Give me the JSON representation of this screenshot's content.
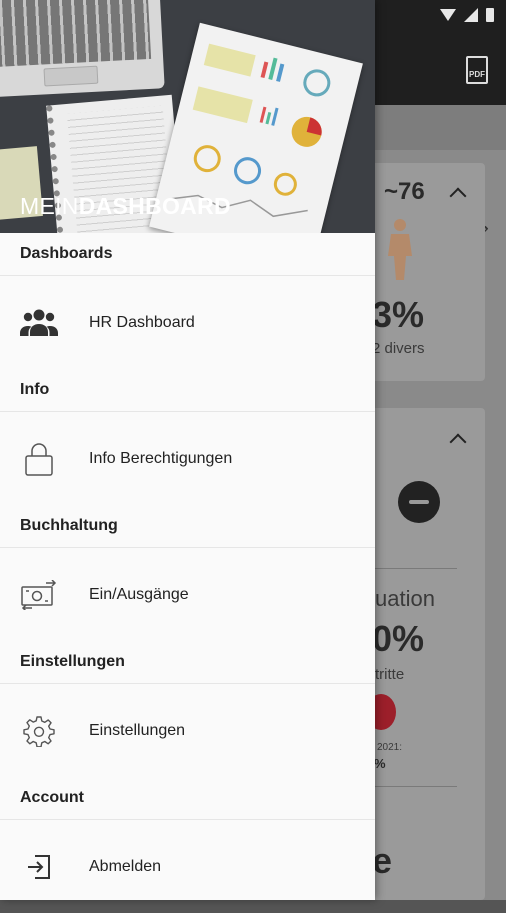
{
  "drawer": {
    "brand_light": "MEIN",
    "brand_bold": "DASHBOARD",
    "sections": [
      {
        "title": "Dashboards",
        "item_label": "HR Dashboard",
        "icon": "people-icon"
      },
      {
        "title": "Info",
        "item_label": "Info Berechtigungen",
        "icon": "lock-icon"
      },
      {
        "title": "Buchhaltung",
        "item_label": "Ein/Ausgänge",
        "icon": "money-exchange-icon"
      },
      {
        "title": "Einstellungen",
        "item_label": "Einstellungen",
        "icon": "gear-icon"
      },
      {
        "title": "Account",
        "item_label": "Abmelden",
        "icon": "logout-icon"
      }
    ]
  },
  "background": {
    "pdf_label": "PDF",
    "age_value": "~76",
    "percent_1": "3%",
    "divers_text": "2 divers",
    "section_text": "uation",
    "percent_2": "0%",
    "exits_text": "tritte",
    "year_text": "i 2021:",
    "small_percent": "%",
    "big_letter": "e"
  },
  "colors": {
    "drawer_bg": "#fafafa",
    "scrim": "#8a8a8a",
    "icon": "#333333"
  }
}
